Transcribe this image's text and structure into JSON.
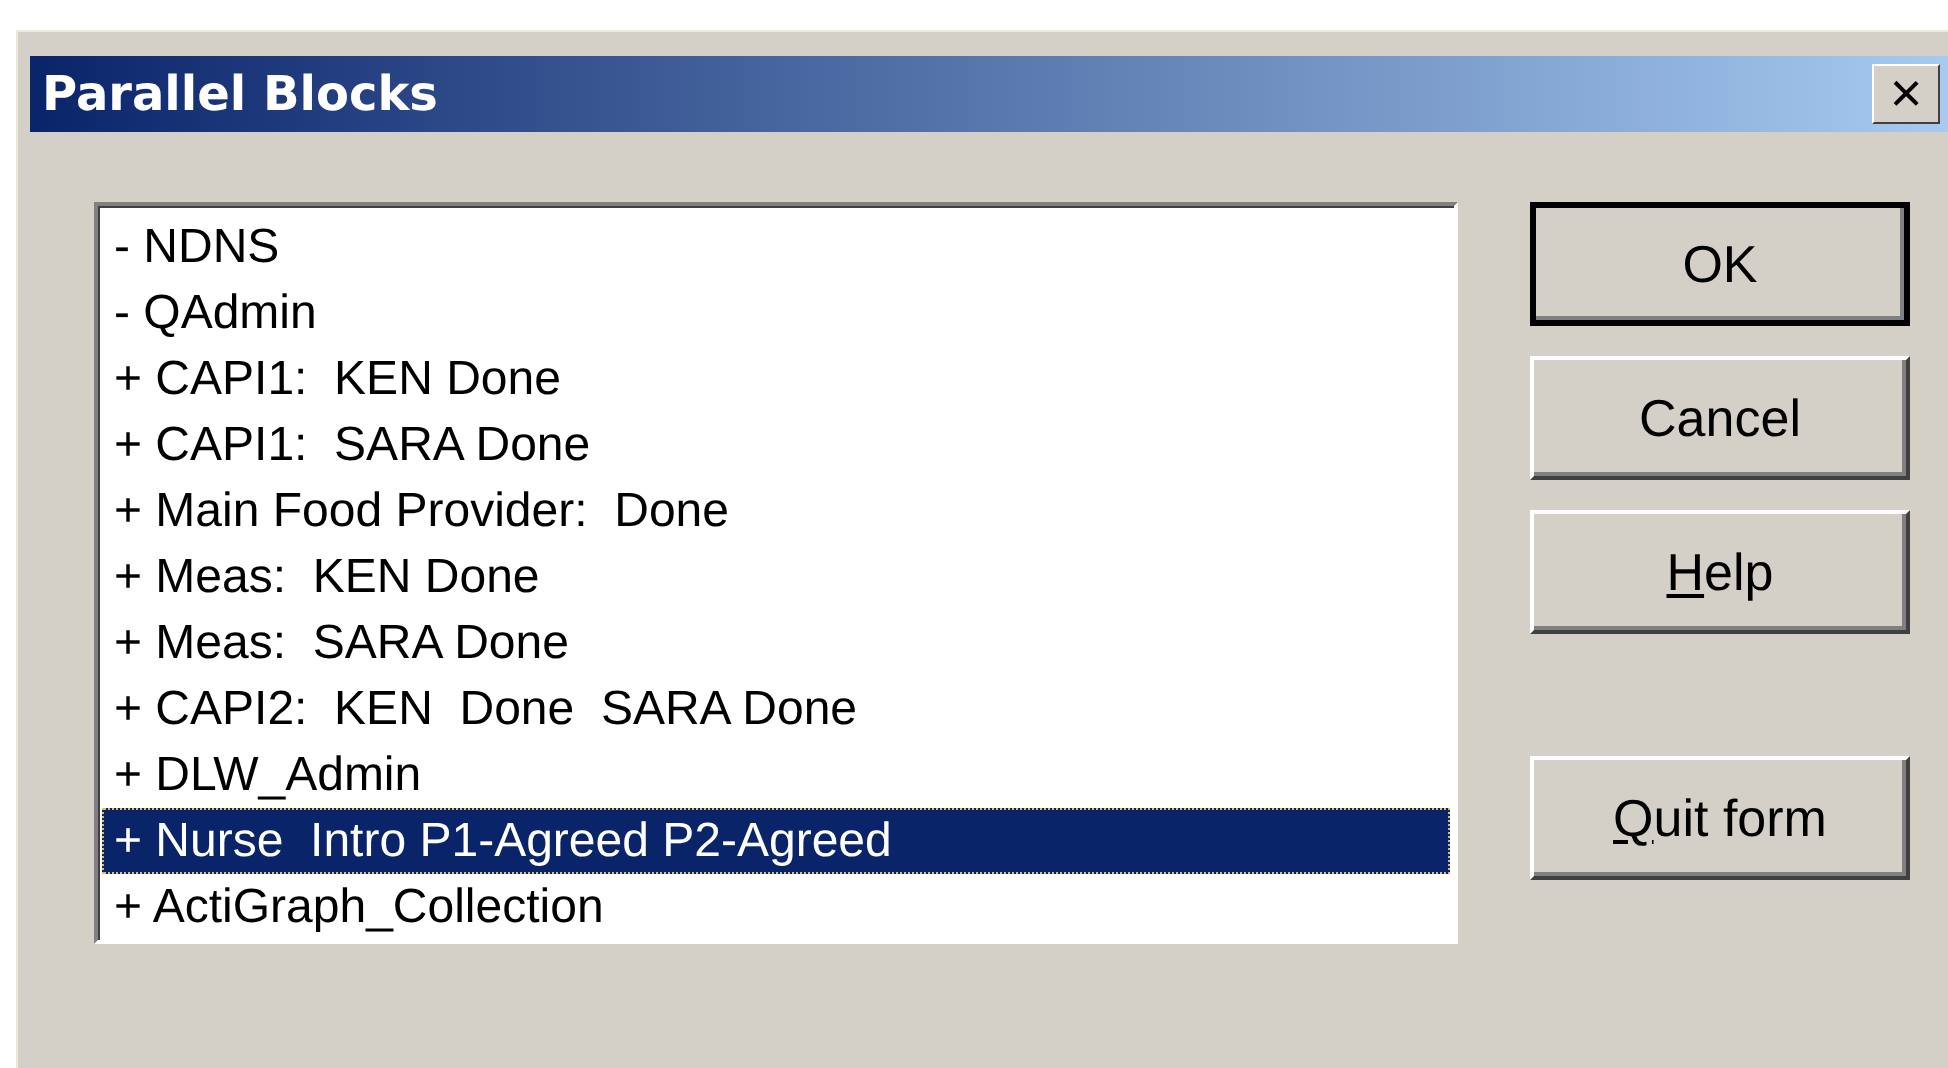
{
  "window": {
    "title": "Parallel Blocks",
    "close": "×"
  },
  "list": {
    "items": [
      {
        "label": "- NDNS",
        "selected": false
      },
      {
        "label": "- QAdmin",
        "selected": false
      },
      {
        "label": "+ CAPI1:  KEN Done",
        "selected": false
      },
      {
        "label": "+ CAPI1:  SARA Done",
        "selected": false
      },
      {
        "label": "+ Main Food Provider:  Done",
        "selected": false
      },
      {
        "label": "+ Meas:  KEN Done",
        "selected": false
      },
      {
        "label": "+ Meas:  SARA Done",
        "selected": false
      },
      {
        "label": "+ CAPI2:  KEN  Done  SARA Done",
        "selected": false
      },
      {
        "label": "+ DLW_Admin",
        "selected": false
      },
      {
        "label": "+ Nurse  Intro P1-Agreed P2-Agreed",
        "selected": true
      },
      {
        "label": "+ ActiGraph_Collection",
        "selected": false
      }
    ]
  },
  "buttons": [
    {
      "label": "OK",
      "default": true,
      "underline_first": false,
      "kind": "button"
    },
    {
      "label": "Cancel",
      "default": false,
      "underline_first": false,
      "kind": "button"
    },
    {
      "label": "Help",
      "default": false,
      "underline_first": true,
      "kind": "button"
    },
    {
      "label": "Quit form",
      "default": false,
      "underline_first": true,
      "kind": "separated"
    }
  ]
}
